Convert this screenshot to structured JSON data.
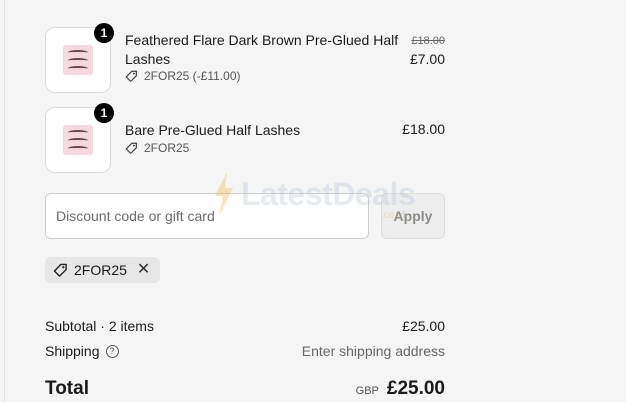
{
  "items": [
    {
      "title": "Feathered Flare Dark Brown Pre-Glued Half Lashes",
      "quantity": "1",
      "discount_line": "2FOR25 (-£11.00)",
      "original_price": "£18.00",
      "price": "£7.00"
    },
    {
      "title": "Bare Pre-Glued Half Lashes",
      "quantity": "1",
      "discount_line": "2FOR25",
      "original_price": "",
      "price": "£18.00"
    }
  ],
  "discount": {
    "placeholder": "Discount code or gift card",
    "value": "",
    "apply_label": "Apply",
    "applied_code": "2FOR25"
  },
  "summary": {
    "subtotal_label": "Subtotal · 2 items",
    "subtotal_value": "£25.00",
    "shipping_label": "Shipping",
    "shipping_value": "Enter shipping address",
    "total_label": "Total",
    "currency": "GBP",
    "total_value": "£25.00"
  },
  "watermark": {
    "text": "LatestDeals",
    "sub": ".co.uk"
  },
  "icons": {
    "tag": "tag-icon",
    "help": "question-circle-icon",
    "remove": "close-icon"
  }
}
